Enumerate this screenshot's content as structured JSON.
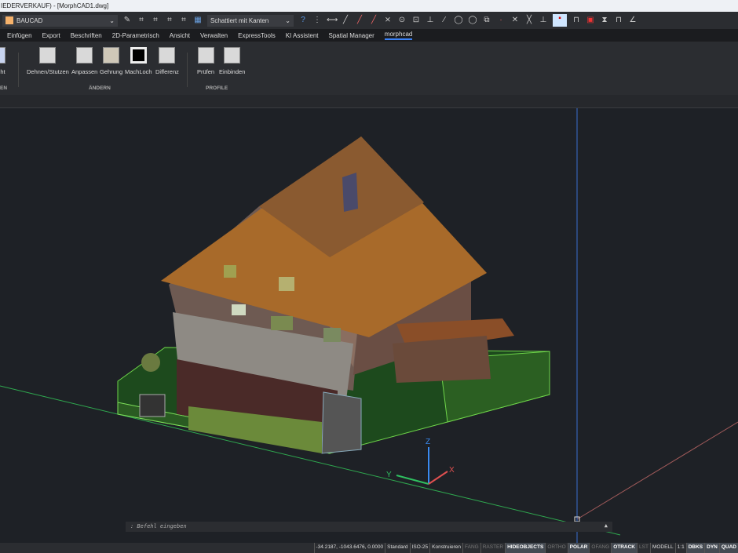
{
  "title": "IEDERVERKAUF) - [MorphCAD1.dwg]",
  "toolbar": {
    "layer": "BAUCAD",
    "layer_color": "#f6b26b",
    "visual_style": "Schattiert mit Kanten"
  },
  "tabs": [
    {
      "label": "Einfügen"
    },
    {
      "label": "Export"
    },
    {
      "label": "Beschriften"
    },
    {
      "label": "2D-Parametrisch"
    },
    {
      "label": "Ansicht"
    },
    {
      "label": "Verwalten"
    },
    {
      "label": "ExpressTools"
    },
    {
      "label": "KI Assistent"
    },
    {
      "label": "Spatial Manager"
    },
    {
      "label": "morphcad",
      "active": true
    }
  ],
  "ribbon": {
    "partial_left_tool": "ht",
    "partial_left_panel": "EN",
    "tools": [
      {
        "label": "Dehnen/Stutzen"
      },
      {
        "label": "Anpassen"
      },
      {
        "label": "Gehrung"
      },
      {
        "label": "MachLoch"
      },
      {
        "label": "Differenz"
      },
      {
        "label": "Prüfen"
      },
      {
        "label": "Einbinden"
      }
    ],
    "panels": {
      "aendern": "ÄNDERN",
      "profile": "PROFILE"
    }
  },
  "viewport": {
    "ucs": {
      "x": "X",
      "y": "Y",
      "z": "Z"
    }
  },
  "command": {
    "placeholder": ": Befehl eingeben",
    "arrow": "▲"
  },
  "status": [
    {
      "label": "-34.2187, -1043.6476, 0.0000",
      "state": "text"
    },
    {
      "label": "Standard",
      "state": "text"
    },
    {
      "label": "ISO-25",
      "state": "text"
    },
    {
      "label": "Konstruieren",
      "state": "text"
    },
    {
      "label": "FANG",
      "state": "off"
    },
    {
      "label": "RASTER",
      "state": "off"
    },
    {
      "label": "HIDEOBJECTS",
      "state": "on"
    },
    {
      "label": "ORTHO",
      "state": "off"
    },
    {
      "label": "POLAR",
      "state": "on"
    },
    {
      "label": "OFANG",
      "state": "off"
    },
    {
      "label": "OTRACK",
      "state": "on"
    },
    {
      "label": "LST",
      "state": "off"
    },
    {
      "label": "MODELL",
      "state": "text"
    },
    {
      "label": "1:1",
      "state": "text"
    },
    {
      "label": "DBKS",
      "state": "on"
    },
    {
      "label": "DYN",
      "state": "on"
    },
    {
      "label": "QUAD",
      "state": "on"
    }
  ]
}
